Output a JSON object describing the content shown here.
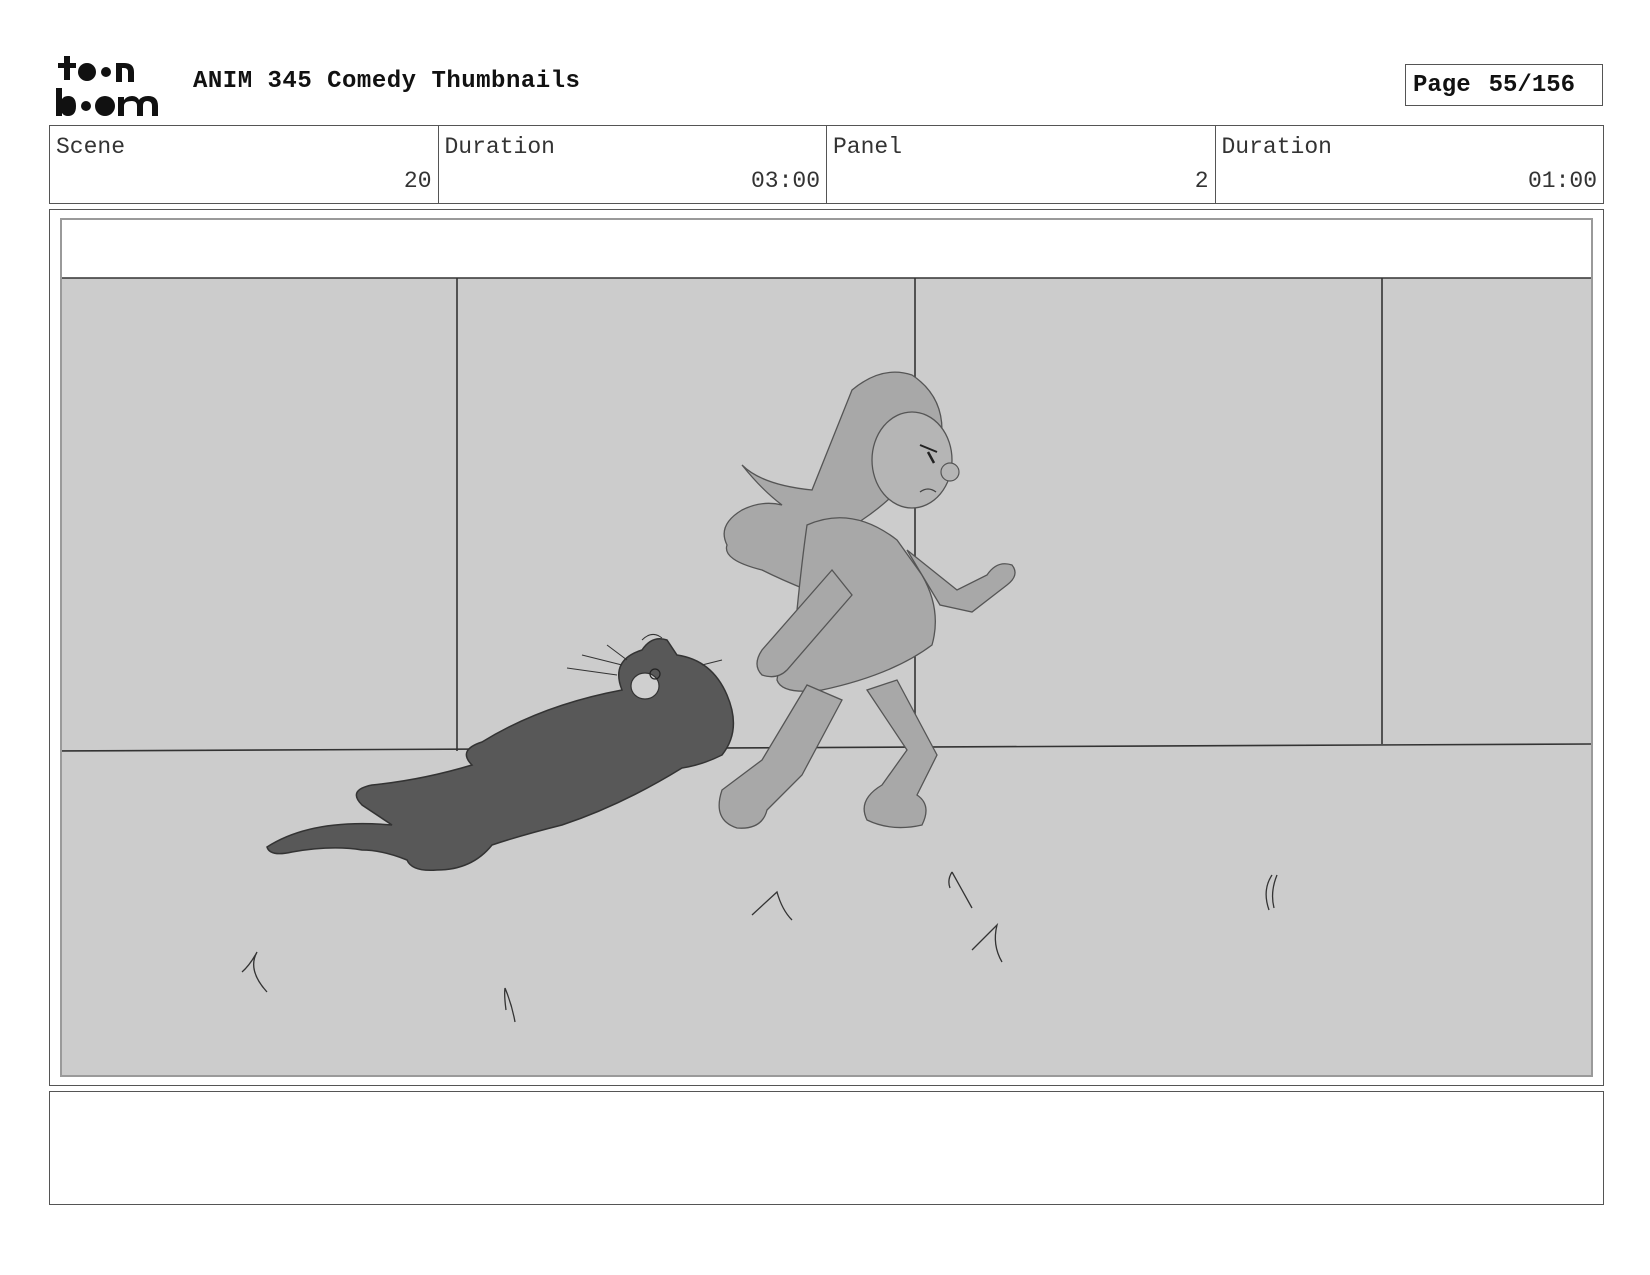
{
  "header": {
    "logo_text": "toonboom",
    "title": "ANIM 345 Comedy Thumbnails",
    "page_label": "Page",
    "page_number": "55/156"
  },
  "info": [
    {
      "label": "Scene",
      "value": "20"
    },
    {
      "label": "Duration",
      "value": "03:00"
    },
    {
      "label": "Panel",
      "value": "2"
    },
    {
      "label": "Duration",
      "value": "01:00"
    }
  ],
  "panel": {
    "description": "",
    "colors": {
      "background": "#cccccc",
      "lines": "#333333",
      "girl": "#a8a8a8",
      "cat": "#585858"
    }
  },
  "notes": ""
}
